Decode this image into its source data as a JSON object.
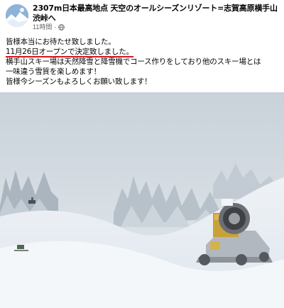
{
  "post": {
    "title": "2307m日本最高地点 天空のオールシーズンリゾート=志賀高原横手山渋峠へ",
    "time": "11時間",
    "visibility_icon": "globe-icon",
    "lines": [
      "皆様本当にお待たせ致しました。",
      "11月26日オープンで決定致しました。",
      "横手山スキー場は天然降雪と降雪機でコース作りをしており他のスキー場とは",
      "一味違う雪質を楽しめます！",
      "皆様今シーズンもよろしくお願い致します！"
    ],
    "highlight_color": "#d9141b"
  }
}
